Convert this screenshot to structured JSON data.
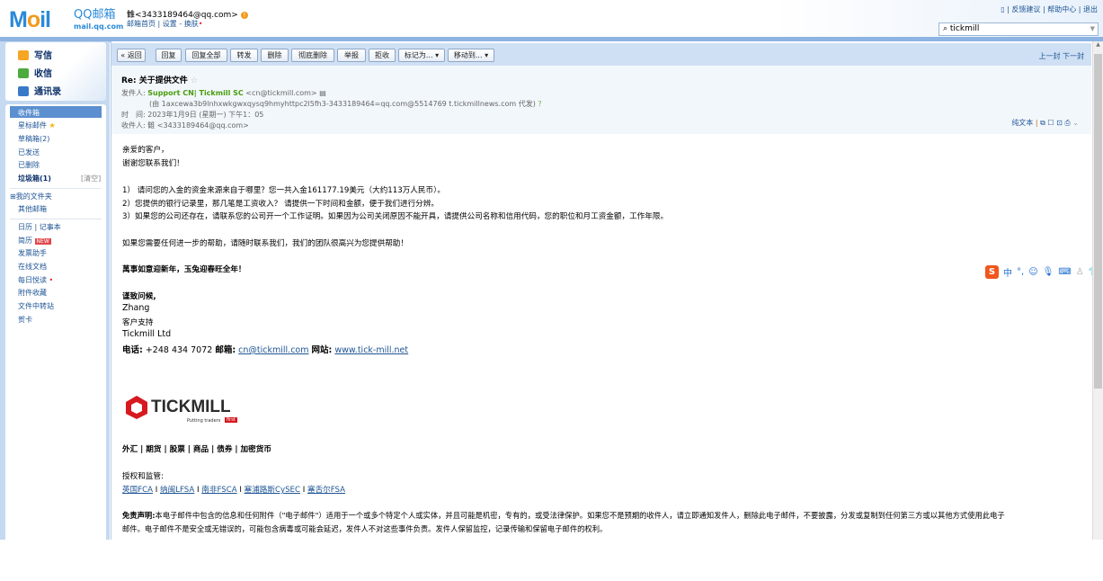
{
  "header": {
    "logo": "MoIl",
    "logo_title": "QQ邮箱",
    "logo_sub": "mail.qq.com",
    "user": "雔<3433189464@qq.com>",
    "links": [
      "邮箱首页",
      "设置",
      "换肤"
    ],
    "top_links": [
      "反馈建议",
      "帮助中心",
      "退出"
    ],
    "search_value": "tickmill"
  },
  "sidebar": {
    "compose": "写信",
    "receive": "收信",
    "contacts": "通讯录",
    "folders": [
      "收件箱",
      "星标邮件",
      "草稿箱(2)",
      "已发送",
      "已删除",
      "垃圾箱(1)"
    ],
    "clear": "[清空]",
    "my_folders": "我的文件夹",
    "other_mail": "其他邮箱",
    "calendar": "日历",
    "notes": "记事本",
    "apps": [
      "简历",
      "发票助手",
      "在线文档",
      "每日悦读",
      "附件收藏",
      "文件中转站",
      "贺卡"
    ],
    "new_badge": "NEW"
  },
  "toolbar": {
    "back": "« 返回",
    "buttons": [
      "回复",
      "回复全部",
      "转发",
      "删除",
      "彻底删除",
      "举报",
      "拒收",
      "标记为...",
      "移动到..."
    ],
    "prev": "上一封",
    "next": "下一封"
  },
  "email": {
    "subject": "Re: 关于提供文件",
    "from_label": "发件人:",
    "from_name": "Support CN| Tickmill SC",
    "from_addr": "<cn@tickmill.com>",
    "via": "(由 1axcewa3b9lnhxwkgwxqysq9hmyhttpc2l5fh3-3433189464=qq.com@5514769 t.tickmillnews.com 代发)",
    "time_label": "时　间:",
    "time": "2023年1月9日 (星期一) 下午1：05",
    "to_label": "收件人:",
    "to": "雔 <3433189464@qq.com>",
    "plain_text": "纯文本",
    "body": [
      "亲爱的客户，",
      "谢谢您联系我们！",
      "1） 请问您的入金的资金来源来自于哪里？您一共入金161177.19美元（大约113万人民币）。",
      "2）您提供的银行记录里，那几笔是工资收入？ 请提供一下时间和金额，便于我们进行分辨。",
      "3）如果您的公司还存在，请联系您的公司开一个工作证明。如果因为公司关闭原因不能开具，请提供公司名称和信用代码，您的职位和月工资金额，工作年限。",
      "如果您需要任何进一步的帮助，请随时联系我们，我们的团队很高兴为您提供帮助！",
      "萬事如意迎新年，玉兔迎春旺全年！"
    ],
    "signature": {
      "closing": "谨致问候,",
      "name": "Zhang",
      "role": "客户支持",
      "company": "Tickmill Ltd",
      "phone_label": "电话:",
      "phone": "+248 434 7072",
      "mail_label": "邮箱:",
      "mail": "cn@tickmill.com",
      "web_label": "网站:",
      "web": "www.tick-mill.net"
    },
    "logo_text": "TICKMILL",
    "logo_tagline": "Putting traders",
    "logo_first": "first",
    "products": "外汇 | 期货 | 股票 | 商品 | 债券 | 加密货币",
    "regulation_label": "授权和监管:",
    "regulators": [
      "英国FCA",
      "纳闽LFSA",
      "南非FSCA",
      "塞浦路斯CySEC",
      "塞舌尔FSA"
    ],
    "disclaimer_label": "免责声明:",
    "disclaimer1": "本电子邮件中包含的信息和任何附件（\"电子邮件\"）适用于一个或多个特定个人或实体，并且可能是机密，专有的，或受法律保护。如果您不是预期的收件人，请立即通知发件人，删除此电子邮件，不要披露，分发或复制到任何第三方或以其他方式使用此电子",
    "disclaimer2": "邮件。电子邮件不是安全或无错误的，可能包含病毒或可能会延迟，发件人不对这些事件负责。发件人保留监控，记录传输和保留电子邮件的权利。"
  },
  "ime": {
    "logo": "S",
    "lang": "中",
    "punct": "°,"
  }
}
